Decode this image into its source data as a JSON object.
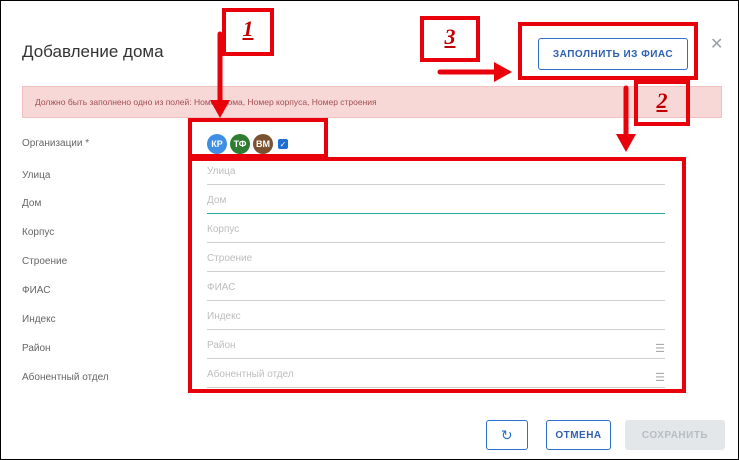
{
  "dialog": {
    "title": "Добавление дома",
    "close_icon": "close-icon",
    "fias_button": "ЗАПОЛНИТЬ ИЗ ФИАС",
    "alert": "Должно быть заполнено одно из полей: Номер дома, Номер корпуса, Номер строения"
  },
  "organizations": {
    "label": "Организации *",
    "chips": [
      {
        "text": "КР",
        "color": "#3e8ee6"
      },
      {
        "text": "ТФ",
        "color": "#2e7d32"
      },
      {
        "text": "ВМ",
        "color": "#7a5230"
      }
    ],
    "check_icon": "checkbox-checked-icon"
  },
  "fields": [
    {
      "label": "Улица",
      "placeholder": "Улица"
    },
    {
      "label": "Дом",
      "placeholder": "Дом"
    },
    {
      "label": "Корпус",
      "placeholder": "Корпус"
    },
    {
      "label": "Строение",
      "placeholder": "Строение"
    },
    {
      "label": "ФИАС",
      "placeholder": "ФИАС"
    },
    {
      "label": "Индекс",
      "placeholder": "Индекс"
    },
    {
      "label": "Район",
      "placeholder": "Район"
    },
    {
      "label": "Абонентный отдел",
      "placeholder": "Абонентный отдел"
    }
  ],
  "buttons": {
    "refresh_icon": "refresh-icon",
    "cancel": "ОТМЕНА",
    "save": "СОХРАНИТЬ"
  },
  "annotations": {
    "one": "1",
    "two": "2",
    "three": "3"
  },
  "colors": {
    "annotation": "#e8000b",
    "accent": "#2e6fc9",
    "alert_bg": "#f8d7d7"
  }
}
